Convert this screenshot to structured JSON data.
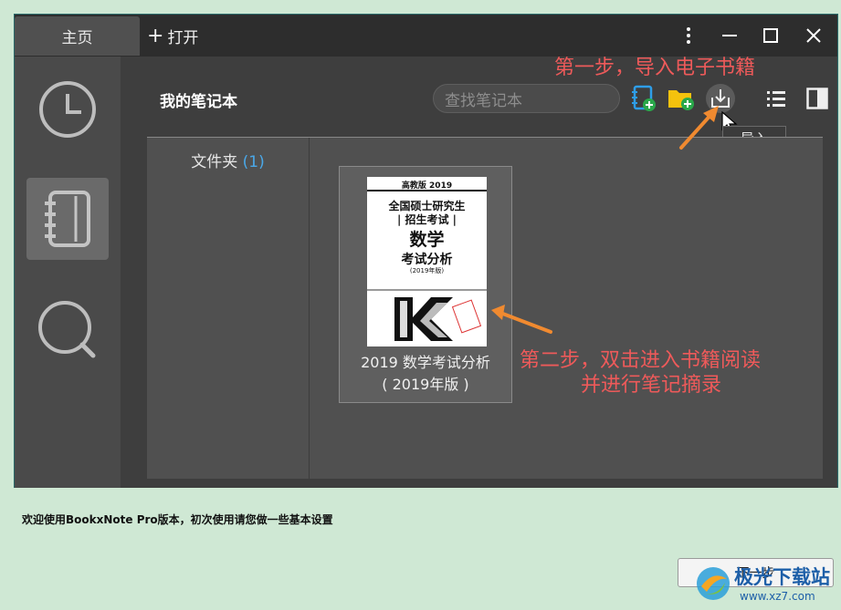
{
  "titlebar": {
    "home_tab": "主页",
    "open_tab": "打开",
    "open_plus": "+"
  },
  "main": {
    "notebook_title": "我的笔记本",
    "search_placeholder": "查找笔记本",
    "tooltip_import": "导入",
    "folder_label": "文件夹",
    "folder_count": "(1)"
  },
  "book": {
    "title_line1": "2019 数学考试分析",
    "title_line2": "( 2019年版 )",
    "cover_edition": "高教版 2019",
    "cover_line1": "全国硕士研究生",
    "cover_line2": "| 招生考试 |",
    "cover_subject": "数学",
    "cover_title": "考试分析",
    "cover_year": "(2019年版)"
  },
  "annotations": {
    "step1": "第一步，导入电子书籍",
    "step2_line1": "第二步，双击进入书籍阅读",
    "step2_line2": "并进行笔记摘录"
  },
  "footer": {
    "status": "欢迎使用BookxNote Pro版本，初次使用请您做一些基本设置",
    "next_button": "下一步"
  },
  "watermark": {
    "text": "极光下载站",
    "url": "www.xz7.com"
  },
  "colors": {
    "annotation": "#ee5a5a",
    "arrow": "#f08a30",
    "accent": "#4aa8e8",
    "background": "#cfe8d4"
  }
}
